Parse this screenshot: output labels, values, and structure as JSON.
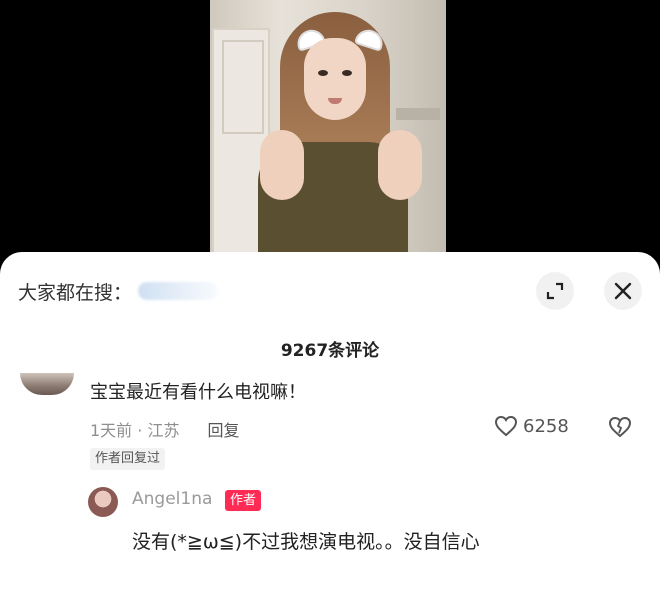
{
  "video": {
    "icons": [
      "door",
      "girl-with-ear-filter"
    ]
  },
  "header": {
    "search_label": "大家都在搜：",
    "expand_icon": "expand-icon",
    "close_icon": "close-icon"
  },
  "comments": {
    "count_text": "9267条评论"
  },
  "comment": {
    "text": "宝宝最近有看什么电视嘛！",
    "time_location": "1天前 · 江苏",
    "reply_label": "回复",
    "like_count": "6258",
    "author_replied_tag": "作者回复过"
  },
  "reply": {
    "username": "Angel1na",
    "author_badge": "作者",
    "text": "没有(*≧ω≦)不过我想演电视。。没自信心"
  },
  "colors": {
    "badge_red": "#ff2b55",
    "meta_gray": "#8f8f8f"
  }
}
